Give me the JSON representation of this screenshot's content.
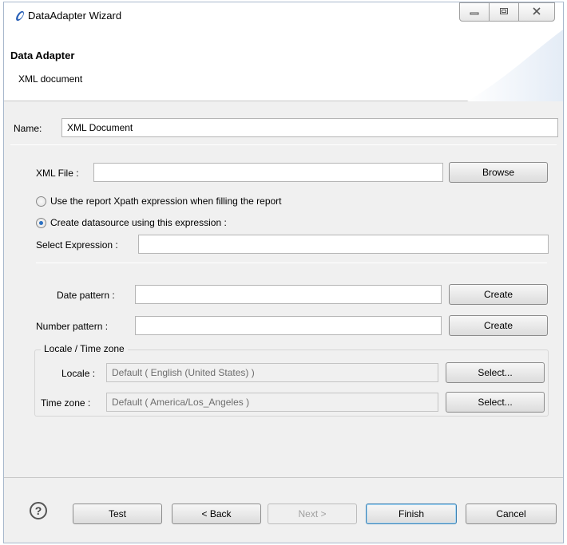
{
  "window": {
    "title": "DataAdapter Wizard"
  },
  "header": {
    "title": "Data Adapter",
    "subtitle": "XML document"
  },
  "form": {
    "name_label": "Name:",
    "name_value": "XML Document",
    "xml_file_label": "XML File :",
    "xml_file_value": "",
    "browse_label": "Browse",
    "radio_xpath_label": "Use the report Xpath expression when filling the report",
    "radio_xpath_checked": false,
    "radio_datasource_label": "Create datasource using this expression :",
    "radio_datasource_checked": true,
    "select_expression_label": "Select Expression :",
    "select_expression_value": "",
    "date_pattern_label": "Date pattern :",
    "date_pattern_value": "",
    "date_create_label": "Create",
    "number_pattern_label": "Number pattern :",
    "number_pattern_value": "",
    "number_create_label": "Create"
  },
  "locale_group": {
    "legend": "Locale / Time zone",
    "locale_label": "Locale :",
    "locale_value": "Default ( English (United States) )",
    "locale_select_label": "Select...",
    "timezone_label": "Time zone :",
    "timezone_value": "Default ( America/Los_Angeles )",
    "timezone_select_label": "Select..."
  },
  "footer": {
    "help_glyph": "?",
    "test_label": "Test",
    "back_label": "< Back",
    "next_label": "Next >",
    "finish_label": "Finish",
    "cancel_label": "Cancel"
  },
  "icons": {
    "app_icon": "eclipse-icon",
    "minimize": "minimize-icon",
    "maximize": "maximize-icon",
    "close": "close-icon",
    "help": "help-icon"
  },
  "colors": {
    "accent": "#2a6fc1",
    "default_button_border": "#3c7fb1"
  }
}
